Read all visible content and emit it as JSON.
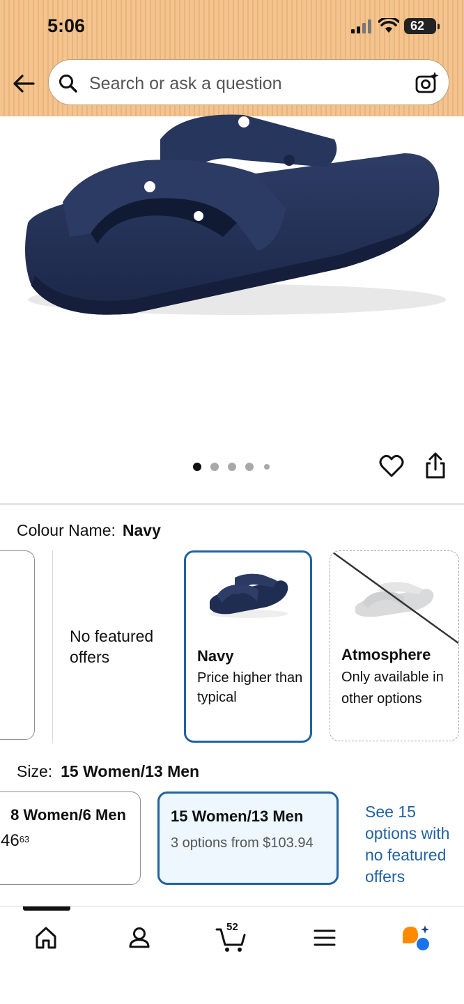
{
  "status_bar": {
    "time": "5:06",
    "battery": "62"
  },
  "search": {
    "placeholder": "Search or ask a question"
  },
  "product": {
    "image_icon": "navy-sandal-image",
    "carousel_count": 5,
    "carousel_active": 1
  },
  "colour": {
    "label": "Colour Name:",
    "selected": "Navy",
    "no_featured": "No featured offers",
    "options": [
      {
        "name": "Navy",
        "note": "Price higher than typical",
        "selected": true,
        "color": "#1f2d52"
      },
      {
        "name": "Atmosphere",
        "note": "Only available in other options",
        "selected": false,
        "color": "#d9dadb"
      }
    ]
  },
  "size": {
    "label": "Size:",
    "selected": "15 Women/13 Men",
    "prev_option": {
      "name": "8 Women/6 Men",
      "price_main": "46",
      "price_cents": "63"
    },
    "selected_option": {
      "name": "15 Women/13 Men",
      "sub": "3 options from $103.94"
    },
    "see_more": "See 15 options with no featured offers"
  },
  "nav": {
    "cart_count": "52"
  },
  "colors": {
    "header_bg": "#f1be88",
    "link_blue": "#2162a1",
    "selected_bg": "#edf7fd"
  }
}
